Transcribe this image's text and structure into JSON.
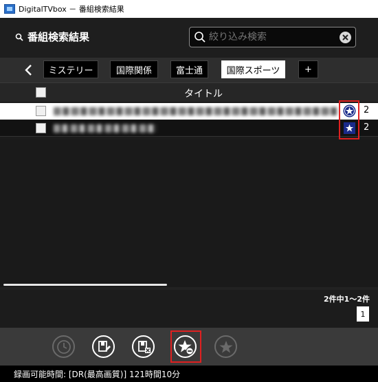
{
  "window": {
    "title": "DigitalTVbox － 番組検索結果"
  },
  "header": {
    "title": "番組検索結果"
  },
  "search": {
    "placeholder": "絞り込み検索",
    "value": ""
  },
  "tabs": [
    {
      "label": "ミステリー",
      "active": false
    },
    {
      "label": "国際関係",
      "active": false
    },
    {
      "label": "富士通",
      "active": false
    },
    {
      "label": "国際スポーツ",
      "active": true
    },
    {
      "label": "+",
      "active": false
    }
  ],
  "table": {
    "column_title": "タイトル",
    "rows": [
      {
        "count": "2",
        "selected": true,
        "star": "circle-star-icon"
      },
      {
        "count": "2",
        "selected": false,
        "star": "square-star-icon"
      }
    ]
  },
  "pagination": {
    "summary": "2件中1～2件",
    "page": "1"
  },
  "actions": [
    {
      "name": "clock-icon",
      "enabled": false
    },
    {
      "name": "edit-reservation-icon",
      "enabled": true
    },
    {
      "name": "delete-reservation-icon",
      "enabled": true
    },
    {
      "name": "remove-favorite-star-icon",
      "enabled": true
    },
    {
      "name": "add-favorite-star-icon",
      "enabled": false
    }
  ],
  "status": {
    "text": "録画可能時間: [DR(最高画質)] 121時間10分"
  },
  "colors": {
    "accent_blue": "#1a2a8a",
    "highlight_red": "#e02020",
    "background": "#1c1c1c"
  }
}
